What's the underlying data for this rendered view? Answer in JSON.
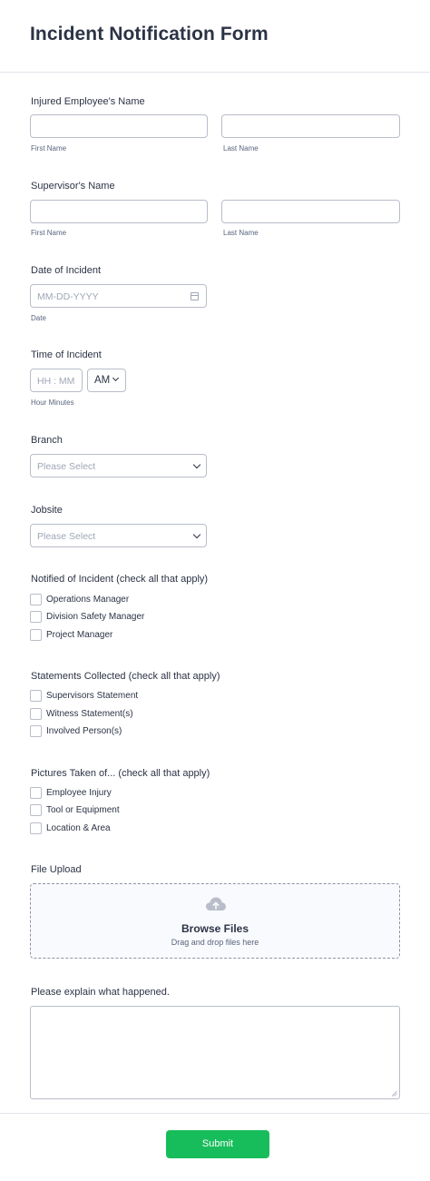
{
  "form": {
    "title": "Incident Notification Form"
  },
  "injured": {
    "label": "Injured Employee's Name",
    "first_sub": "First Name",
    "last_sub": "Last Name"
  },
  "supervisor": {
    "label": "Supervisor's Name",
    "first_sub": "First Name",
    "last_sub": "Last Name"
  },
  "date": {
    "label": "Date of Incident",
    "placeholder": "MM-DD-YYYY",
    "sub": "Date"
  },
  "time": {
    "label": "Time of Incident",
    "placeholder": "HH : MM",
    "ampm": "AM",
    "sub": "Hour Minutes"
  },
  "branch": {
    "label": "Branch",
    "placeholder": "Please Select"
  },
  "jobsite": {
    "label": "Jobsite",
    "placeholder": "Please Select"
  },
  "notified": {
    "label": "Notified of Incident (check all that apply)",
    "options": [
      "Operations Manager",
      "Division Safety Manager",
      "Project Manager"
    ]
  },
  "statements": {
    "label": "Statements Collected (check all that apply)",
    "options": [
      "Supervisors Statement",
      "Witness Statement(s)",
      "Involved Person(s)"
    ]
  },
  "pictures": {
    "label": "Pictures Taken of... (check all that apply)",
    "options": [
      "Employee Injury",
      "Tool or Equipment",
      "Location & Area"
    ]
  },
  "upload": {
    "label": "File Upload",
    "title": "Browse Files",
    "subtitle": "Drag and drop files here"
  },
  "explain": {
    "label": "Please explain what happened."
  },
  "submit": {
    "label": "Submit",
    "color": "#18bd5b"
  }
}
